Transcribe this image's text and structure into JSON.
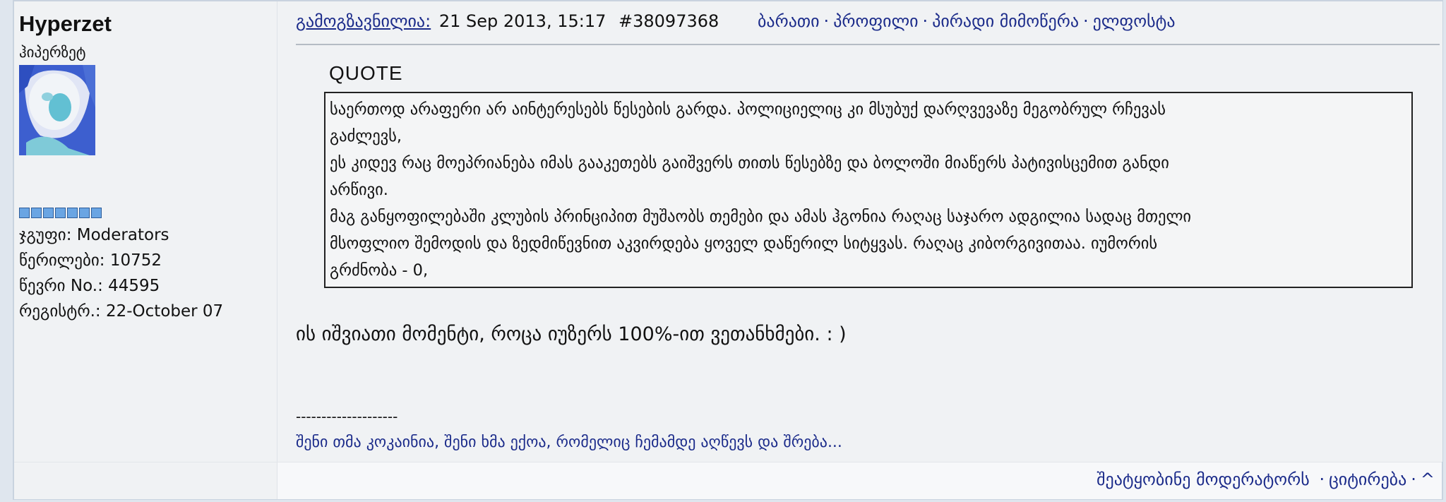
{
  "author": {
    "username": "Hyperzet",
    "title": "ჰიპერზეტ",
    "group_line": "ჯგუფი: Moderators",
    "posts_line": "წერილები: 10752",
    "member_no_line": "წევრი No.: 44595",
    "registered_line": "რეგისტრ.: 22-October 07",
    "rank_pips": 7
  },
  "post": {
    "posted_label": "გამოგზავნილია:",
    "date": "21 Sep 2013, 15:17",
    "id": "#38097368",
    "nav": {
      "card": "ბარათი",
      "profile": "პროფილი",
      "pm": "პირადი მიმოწერა",
      "email": "ელფოსტა",
      "separator": "·"
    },
    "quote_title": "QUOTE",
    "quote_lines": [
      "საერთოდ არაფერი არ აინტერესებს წესების გარდა. პოლიციელიც კი მსუბუქ დარღვევაზე მეგობრულ რჩევას",
      "გაძლევს,",
      "ეს კიდევ რაც მოეპრიანება იმას გააკეთებს გაიშვერს თითს წესებზე და ბოლოში მიაწერს პატივისცემით განდი",
      "არწივი.",
      "მაგ განყოფილებაში კლუბის პრინციპით მუშაობს თემები და ამას ჰგონია რაღაც საჯარო ადგილია სადაც მთელი",
      "მსოფლიო შემოდის და ზედმიწევნით აკვირდება ყოველ დაწერილ სიტყვას. რაღაც კიბორგივითაა. იუმორის",
      "გრძნობა - 0,"
    ],
    "reply": "ის იშვიათი მომენტი, როცა იუზერს 100%-ით ვეთანხმები. : )",
    "signature_divider": "--------------------",
    "signature": "შენი თმა კოკაინია, შენი ხმა ექოა, რომელიც ჩემამდე აღწევს და შრება..."
  },
  "footer": {
    "report": "შეატყობინე მოდერატორს",
    "quote": "ციტირება",
    "top": "^",
    "separator": "·"
  },
  "colors": {
    "link": "#1b2b8a",
    "pip_fill": "#6aa5e3",
    "panel_bg": "#f0f2f4"
  },
  "icons": {
    "avatar": "avatar-image"
  }
}
